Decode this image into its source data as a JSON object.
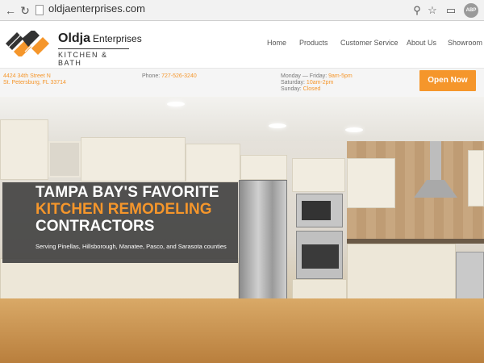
{
  "browser": {
    "url": "oldjaenterprises.com",
    "adblock_label": "ABP",
    "icons": [
      "back-icon",
      "reload-icon",
      "page-icon",
      "zoom-icon",
      "star-icon",
      "cast-icon",
      "menu-icon"
    ]
  },
  "brand": {
    "name": "Oldja",
    "name_suffix": "Enterprises",
    "tagline": "KITCHEN & BATH",
    "colors": {
      "accent": "#f5962b",
      "logo_dark": "#333333"
    }
  },
  "nav": {
    "items": [
      "Home",
      "Products",
      "Customer Service",
      "About Us",
      "Showroom"
    ],
    "active": "Home"
  },
  "info": {
    "address_line1": "4424 34th Street N",
    "address_line2": "St. Petersburg, FL 33714",
    "phone_label": "Phone:",
    "phone": "727-526-3240",
    "hours": [
      {
        "day": "Monday — Friday:",
        "time": "9am-5pm"
      },
      {
        "day": "Saturday:",
        "time": "10am-2pm"
      },
      {
        "day": "Sunday:",
        "time": "Closed"
      }
    ],
    "open_button": "Open Now"
  },
  "hero": {
    "headline_line1": "TAMPA BAY'S FAVORITE",
    "headline_line2": "KITCHEN REMODELING",
    "headline_line3": "CONTRACTORS",
    "subtext": "Serving Pinellas, Hillsborough, Manatee, Pasco, and Sarasota counties"
  }
}
